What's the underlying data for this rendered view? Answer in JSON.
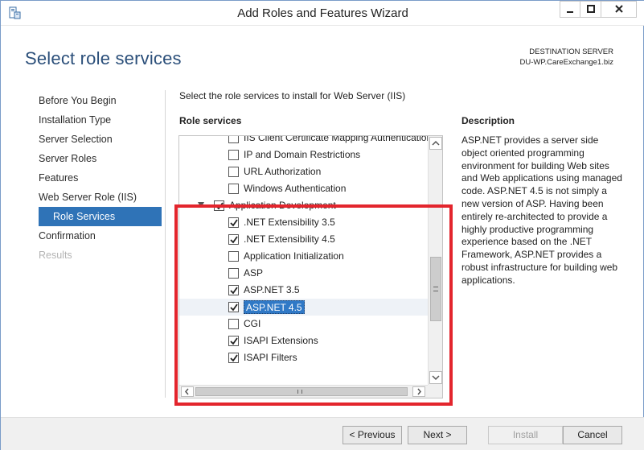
{
  "window": {
    "title": "Add Roles and Features Wizard"
  },
  "header": {
    "page_title": "Select role services",
    "destination_label": "DESTINATION SERVER",
    "destination_value": "DU-WP.CareExchange1.biz"
  },
  "nav": {
    "items": [
      {
        "label": "Before You Begin",
        "state": "normal"
      },
      {
        "label": "Installation Type",
        "state": "normal"
      },
      {
        "label": "Server Selection",
        "state": "normal"
      },
      {
        "label": "Server Roles",
        "state": "normal"
      },
      {
        "label": "Features",
        "state": "normal"
      },
      {
        "label": "Web Server Role (IIS)",
        "state": "normal"
      },
      {
        "label": "Role Services",
        "state": "active"
      },
      {
        "label": "Confirmation",
        "state": "normal"
      },
      {
        "label": "Results",
        "state": "disabled"
      }
    ]
  },
  "main": {
    "instructions": "Select the role services to install for Web Server (IIS)",
    "role_services_header": "Role services",
    "tree": [
      {
        "label": "IIS Client Certificate Mapping Authentication",
        "checked": false,
        "indent": 2
      },
      {
        "label": "IP and Domain Restrictions",
        "checked": false,
        "indent": 2
      },
      {
        "label": "URL Authorization",
        "checked": false,
        "indent": 2
      },
      {
        "label": "Windows Authentication",
        "checked": false,
        "indent": 2
      },
      {
        "label": "Application Development",
        "checked": true,
        "indent": 1,
        "expandable": true
      },
      {
        "label": ".NET Extensibility 3.5",
        "checked": true,
        "indent": 2
      },
      {
        "label": ".NET Extensibility 4.5",
        "checked": true,
        "indent": 2
      },
      {
        "label": "Application Initialization",
        "checked": false,
        "indent": 2
      },
      {
        "label": "ASP",
        "checked": false,
        "indent": 2
      },
      {
        "label": "ASP.NET 3.5",
        "checked": true,
        "indent": 2
      },
      {
        "label": "ASP.NET 4.5",
        "checked": true,
        "indent": 2,
        "selected": true
      },
      {
        "label": "CGI",
        "checked": false,
        "indent": 2
      },
      {
        "label": "ISAPI Extensions",
        "checked": true,
        "indent": 2
      },
      {
        "label": "ISAPI Filters",
        "checked": true,
        "indent": 2
      }
    ]
  },
  "description": {
    "header": "Description",
    "body": "ASP.NET provides a server side object oriented programming environment for building Web sites and Web applications using managed code. ASP.NET 4.5 is not simply a new version of ASP. Having been entirely re-architected to provide a highly productive programming experience based on the .NET Framework, ASP.NET provides a robust infrastructure for building web applications."
  },
  "footer": {
    "previous_label": "< Previous",
    "next_label": "Next >",
    "install_label": "Install",
    "cancel_label": "Cancel"
  },
  "colors": {
    "accent": "#2f73b7",
    "highlight_annotation": "#e3252d",
    "title_text": "#2b4f7a"
  }
}
